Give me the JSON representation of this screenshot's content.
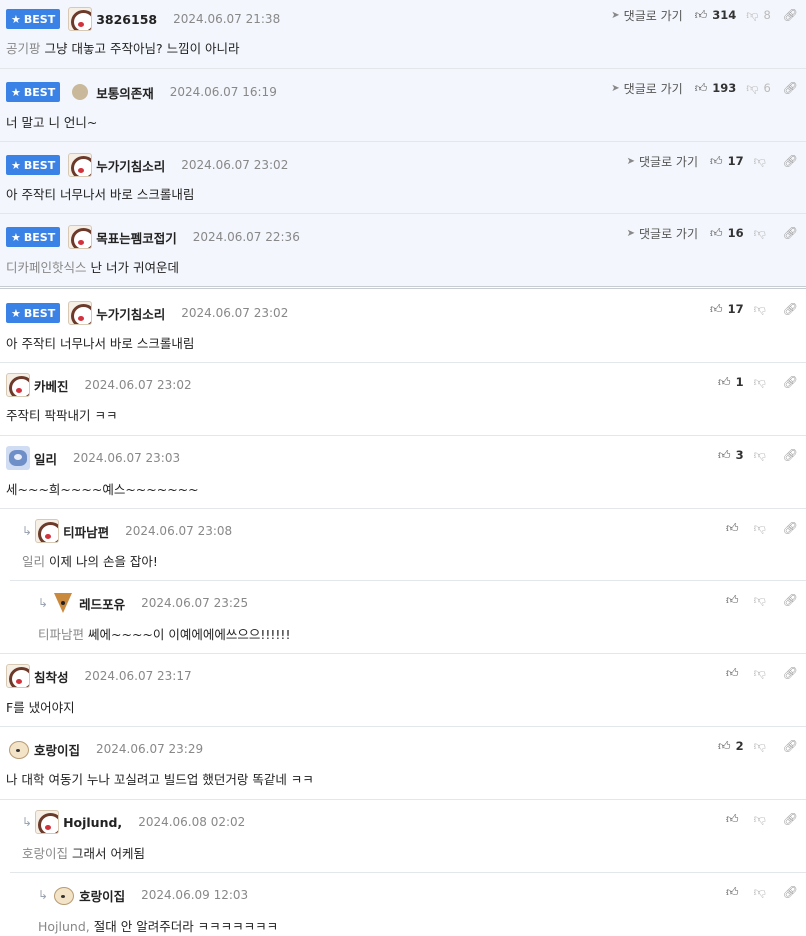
{
  "labels": {
    "best": "BEST",
    "goto_comment": "댓글로 가기"
  },
  "icons": {
    "star": "★",
    "send": "➤",
    "thumb_up": "👍︎",
    "thumb_down": "👎︎",
    "link": "🔗︎",
    "reply": "↳"
  },
  "best_comments": [
    {
      "nick": "3826158",
      "date": "2024.06.07 21:38",
      "ref": "공기팡",
      "text": "그냥 대놓고 주작아님? 느낌이 아니라",
      "likes": "314",
      "dislikes": "8"
    },
    {
      "nick": "보통의존재",
      "date": "2024.06.07 16:19",
      "ref": "",
      "text": "너 말고 니 언니~",
      "likes": "193",
      "dislikes": "6"
    },
    {
      "nick": "누가기침소리",
      "date": "2024.06.07 23:02",
      "ref": "",
      "text": "아 주작티 너무나서 바로 스크롤내림",
      "likes": "17",
      "dislikes": ""
    },
    {
      "nick": "목표는펨코접기",
      "date": "2024.06.07 22:36",
      "ref": "디카페인핫식스",
      "text": "난 너가 귀여운데",
      "likes": "16",
      "dislikes": ""
    }
  ],
  "comments": [
    {
      "nick": "누가기침소리",
      "date": "2024.06.07 23:02",
      "ref": "",
      "text": "아 주작티 너무나서 바로 스크롤내림",
      "likes": "17"
    },
    {
      "nick": "카베진",
      "date": "2024.06.07 23:02",
      "ref": "",
      "text": "주작티 팍팍내기 ㅋㅋ",
      "likes": "1"
    },
    {
      "nick": "일리",
      "date": "2024.06.07 23:03",
      "ref": "",
      "text": "세~~~희~~~~예스~~~~~~~",
      "likes": "3"
    },
    {
      "nick": "티파남편",
      "date": "2024.06.07 23:08",
      "ref": "일리",
      "text": "이제 나의 손을 잡아!",
      "likes": ""
    },
    {
      "nick": "레드포유",
      "date": "2024.06.07 23:25",
      "ref": "티파남편",
      "text": "쎄에~~~~이 이예에에에쓰으으!!!!!!",
      "likes": ""
    },
    {
      "nick": "침착성",
      "date": "2024.06.07 23:17",
      "ref": "",
      "text": "F를 냈어야지",
      "likes": ""
    },
    {
      "nick": "호랑이집",
      "date": "2024.06.07 23:29",
      "ref": "",
      "text": "나 대학 여동기 누나 꼬실려고 빌드업 했던거랑 똑같네 ㅋㅋ",
      "likes": "2"
    },
    {
      "nick": "Hojlund,",
      "date": "2024.06.08 02:02",
      "ref": "호랑이집",
      "text": "그래서 어케됨",
      "likes": ""
    },
    {
      "nick": "호랑이집",
      "date": "2024.06.09 12:03",
      "ref": "Hojlund,",
      "text": "절대 안 알려주더라 ㅋㅋㅋㅋㅋㅋㅋ",
      "likes": ""
    }
  ]
}
